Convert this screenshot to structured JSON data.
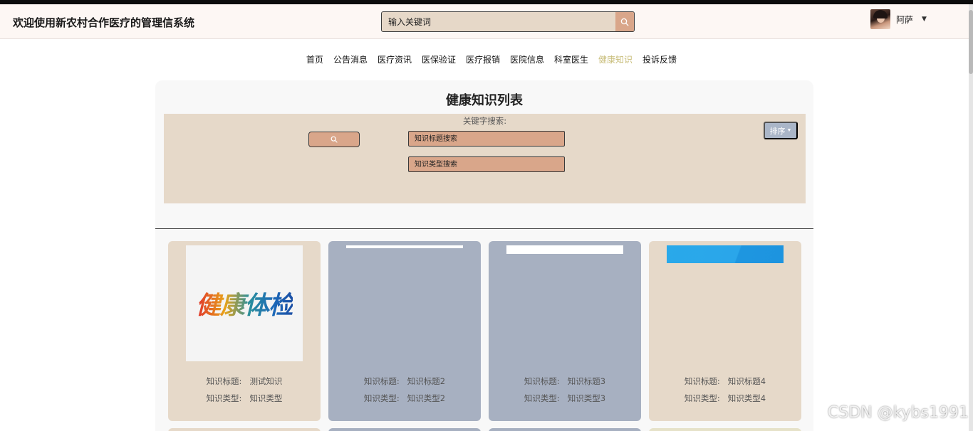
{
  "header": {
    "site_title": "欢迎使用新农村合作医疗的管理信系统",
    "search_placeholder": "输入关键词",
    "username": "阿萨"
  },
  "nav": {
    "items": [
      "首页",
      "公告消息",
      "医疗资讯",
      "医保验证",
      "医疗报销",
      "医院信息",
      "科室医生",
      "健康知识",
      "投诉反馈"
    ],
    "active": "健康知识"
  },
  "list": {
    "title": "健康知识列表",
    "keyword_label": "关键字搜索:",
    "title_search_placeholder": "知识标题搜索",
    "type_search_placeholder": "知识类型搜索",
    "sort_label": "排序"
  },
  "cards": [
    {
      "image_text": "健康体检",
      "title_key": "知识标题:",
      "title": "测试知识",
      "type_key": "知识类型:",
      "type": "知识类型"
    },
    {
      "title_key": "知识标题:",
      "title": "知识标题2",
      "type_key": "知识类型:",
      "type": "知识类型2"
    },
    {
      "title_key": "知识标题:",
      "title": "知识标题3",
      "type_key": "知识类型:",
      "type": "知识类型3"
    },
    {
      "title_key": "知识标题:",
      "title": "知识标题4",
      "type_key": "知识类型:",
      "type": "知识类型4"
    }
  ],
  "watermark": "CSDN @kybs1991",
  "colors": {
    "accent_tan": "#e6d9c9",
    "accent_peach": "#d9a68a",
    "card_blue": "#a7b0c1",
    "nav_active": "#c8bd7a",
    "sort_button": "#aab6c8"
  }
}
